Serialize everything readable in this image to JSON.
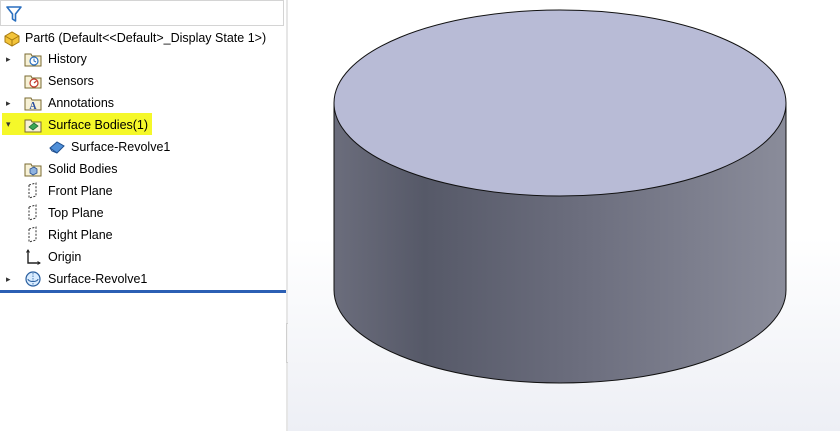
{
  "tree": {
    "part": {
      "label": "Part6  (Default<<Default>_Display State 1>)"
    },
    "items": [
      {
        "label": "History",
        "icon": "history-folder-icon",
        "expandable": true
      },
      {
        "label": "Sensors",
        "icon": "sensors-folder-icon",
        "expandable": false
      },
      {
        "label": "Annotations",
        "icon": "annotations-folder-icon",
        "expandable": true
      },
      {
        "label": "Surface Bodies(1)",
        "icon": "surface-bodies-folder-icon",
        "expandable": true,
        "expanded": true,
        "highlighted": true
      },
      {
        "label": "Surface-Revolve1",
        "icon": "surface-body-icon",
        "child": true
      },
      {
        "label": "Solid Bodies",
        "icon": "solid-bodies-folder-icon",
        "expandable": false
      },
      {
        "label": "Front Plane",
        "icon": "plane-icon"
      },
      {
        "label": "Top Plane",
        "icon": "plane-icon"
      },
      {
        "label": "Right Plane",
        "icon": "plane-icon"
      },
      {
        "label": "Origin",
        "icon": "origin-icon"
      },
      {
        "label": "Surface-Revolve1",
        "icon": "revolve-feature-icon",
        "expandable": true
      }
    ]
  },
  "colors": {
    "highlight": "#f5f82a",
    "cylinder_top": "#b8bbd6",
    "cylinder_side_dark": "#5b5e6d",
    "cylinder_side_light": "#8a8c9a",
    "accent_line": "#2b5fb4"
  }
}
